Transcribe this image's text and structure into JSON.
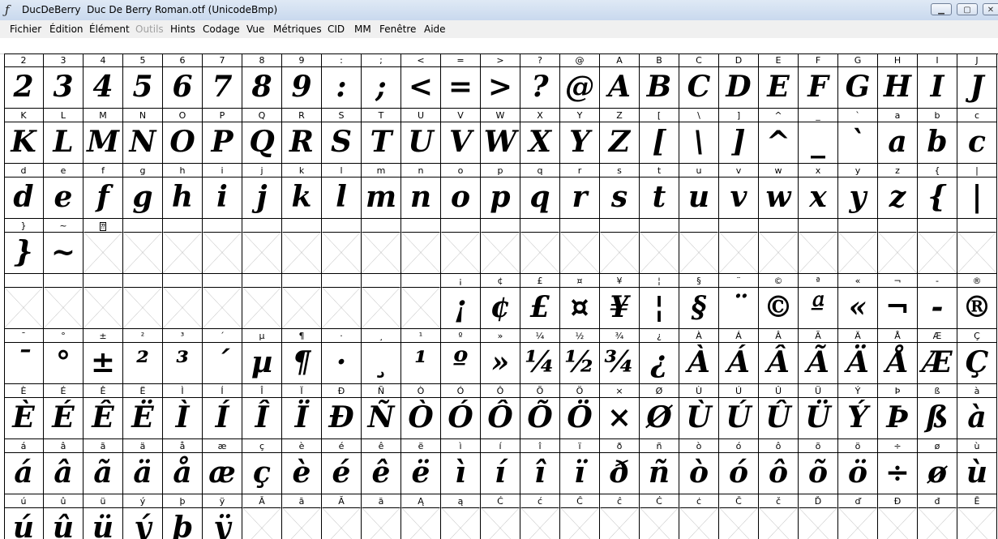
{
  "window": {
    "title": "DucDeBerry  Duc De Berry Roman.otf (UnicodeBmp)",
    "app_icon": "font-forge-icon",
    "minimize_label": "▁",
    "maximize_label": "▢",
    "close_label": "✕"
  },
  "menu": [
    {
      "label": "Fichier",
      "enabled": true
    },
    {
      "label": "Édition",
      "enabled": true
    },
    {
      "label": "Élément",
      "enabled": true
    },
    {
      "label": "Outils",
      "enabled": false
    },
    {
      "label": "Hints",
      "enabled": true
    },
    {
      "label": "Codage",
      "enabled": true
    },
    {
      "label": "Vue",
      "enabled": true
    },
    {
      "label": "Métriques",
      "enabled": true
    },
    {
      "label": "CID",
      "enabled": true
    },
    {
      "label": "MM",
      "enabled": true
    },
    {
      "label": "Fenêtre",
      "enabled": true
    },
    {
      "label": "Aide",
      "enabled": true
    }
  ],
  "grid": {
    "empty_glyph_style": "crossed-box",
    "rows": [
      {
        "labels": [
          "2",
          "3",
          "4",
          "5",
          "6",
          "7",
          "8",
          "9",
          ":",
          ";",
          "<",
          "=",
          ">",
          "?",
          "@",
          "A",
          "B",
          "C",
          "D",
          "E",
          "F",
          "G",
          "H",
          "I",
          "J"
        ],
        "glyphs": [
          "2",
          "3",
          "4",
          "5",
          "6",
          "7",
          "8",
          "9",
          ":",
          ";",
          "<",
          "=",
          ">",
          "?",
          "@",
          "A",
          "B",
          "C",
          "D",
          "E",
          "F",
          "G",
          "H",
          "I",
          "J"
        ]
      },
      {
        "labels": [
          "K",
          "L",
          "M",
          "N",
          "O",
          "P",
          "Q",
          "R",
          "S",
          "T",
          "U",
          "V",
          "W",
          "X",
          "Y",
          "Z",
          "[",
          "\\",
          "]",
          "^",
          "_",
          "`",
          "a",
          "b",
          "c"
        ],
        "glyphs": [
          "K",
          "L",
          "M",
          "N",
          "O",
          "P",
          "Q",
          "R",
          "S",
          "T",
          "U",
          "V",
          "W",
          "X",
          "Y",
          "Z",
          "[",
          "\\",
          "]",
          "^",
          "_",
          "`",
          "a",
          "b",
          "c"
        ]
      },
      {
        "labels": [
          "d",
          "e",
          "f",
          "g",
          "h",
          "i",
          "j",
          "k",
          "l",
          "m",
          "n",
          "o",
          "p",
          "q",
          "r",
          "s",
          "t",
          "u",
          "v",
          "w",
          "x",
          "y",
          "z",
          "{",
          "|"
        ],
        "glyphs": [
          "d",
          "e",
          "f",
          "g",
          "h",
          "i",
          "j",
          "k",
          "l",
          "m",
          "n",
          "o",
          "p",
          "q",
          "r",
          "s",
          "t",
          "u",
          "v",
          "w",
          "x",
          "y",
          "z",
          "{",
          "|"
        ]
      },
      {
        "labels": [
          "}",
          "~",
          "⁇",
          "",
          "",
          "",
          "",
          "",
          "",
          "",
          "",
          "",
          "",
          "",
          "",
          "",
          "",
          "",
          "",
          "",
          "",
          "",
          "",
          "",
          ""
        ],
        "glyphs": [
          "}",
          "~",
          "",
          "",
          "",
          "",
          "",
          "",
          "",
          "",
          "",
          "",
          "",
          "",
          "",
          "",
          "",
          "",
          "",
          "",
          "",
          "",
          "",
          "",
          ""
        ]
      },
      {
        "labels": [
          "",
          "",
          "",
          "",
          "",
          "",
          "",
          "",
          "",
          "",
          "",
          "¡",
          "¢",
          "£",
          "¤",
          "¥",
          "¦",
          "§",
          "¨",
          "©",
          "ª",
          "«",
          "¬",
          "-",
          "®"
        ],
        "glyphs": [
          "",
          "",
          "",
          "",
          "",
          "",
          "",
          "",
          "",
          "",
          "",
          "¡",
          "¢",
          "£",
          "¤",
          "¥",
          "¦",
          "§",
          "¨",
          "©",
          "ª",
          "«",
          "¬",
          "-",
          "®"
        ]
      },
      {
        "labels": [
          "¯",
          "°",
          "±",
          "²",
          "³",
          "´",
          "µ",
          "¶",
          "·",
          "¸",
          "¹",
          "º",
          "»",
          "¼",
          "½",
          "¾",
          "¿",
          "À",
          "Á",
          "Â",
          "Ã",
          "Ä",
          "Å",
          "Æ",
          "Ç"
        ],
        "glyphs": [
          "¯",
          "°",
          "±",
          "²",
          "³",
          "´",
          "µ",
          "¶",
          "·",
          "¸",
          "¹",
          "º",
          "»",
          "¼",
          "½",
          "¾",
          "¿",
          "À",
          "Á",
          "Â",
          "Ã",
          "Ä",
          "Å",
          "Æ",
          "Ç"
        ]
      },
      {
        "labels": [
          "È",
          "É",
          "Ê",
          "Ë",
          "Ì",
          "Í",
          "Î",
          "Ï",
          "Ð",
          "Ñ",
          "Ò",
          "Ó",
          "Ô",
          "Õ",
          "Ö",
          "×",
          "Ø",
          "Ù",
          "Ú",
          "Û",
          "Ü",
          "Ý",
          "Þ",
          "ß",
          "à"
        ],
        "glyphs": [
          "È",
          "É",
          "Ê",
          "Ë",
          "Ì",
          "Í",
          "Î",
          "Ï",
          "Ð",
          "Ñ",
          "Ò",
          "Ó",
          "Ô",
          "Õ",
          "Ö",
          "×",
          "Ø",
          "Ù",
          "Ú",
          "Û",
          "Ü",
          "Ý",
          "Þ",
          "ß",
          "à"
        ]
      },
      {
        "labels": [
          "á",
          "â",
          "ã",
          "ä",
          "å",
          "æ",
          "ç",
          "è",
          "é",
          "ê",
          "ë",
          "ì",
          "í",
          "î",
          "ï",
          "ð",
          "ñ",
          "ò",
          "ó",
          "ô",
          "õ",
          "ö",
          "÷",
          "ø",
          "ù"
        ],
        "glyphs": [
          "á",
          "â",
          "ã",
          "ä",
          "å",
          "æ",
          "ç",
          "è",
          "é",
          "ê",
          "ë",
          "ì",
          "í",
          "î",
          "ï",
          "ð",
          "ñ",
          "ò",
          "ó",
          "ô",
          "õ",
          "ö",
          "÷",
          "ø",
          "ù"
        ]
      },
      {
        "labels": [
          "ú",
          "û",
          "ü",
          "ý",
          "þ",
          "ÿ",
          "Ā",
          "ā",
          "Ă",
          "ă",
          "Ą",
          "ą",
          "Ć",
          "ć",
          "Ĉ",
          "ĉ",
          "Ċ",
          "ċ",
          "Č",
          "č",
          "Ď",
          "ď",
          "Đ",
          "đ",
          "Ē"
        ],
        "glyphs": [
          "ú",
          "û",
          "ü",
          "ý",
          "þ",
          "ÿ",
          "",
          "",
          "",
          "",
          "",
          "",
          "",
          "",
          "",
          "",
          "",
          "",
          "",
          "",
          "",
          "",
          "",
          "",
          ""
        ]
      }
    ]
  }
}
